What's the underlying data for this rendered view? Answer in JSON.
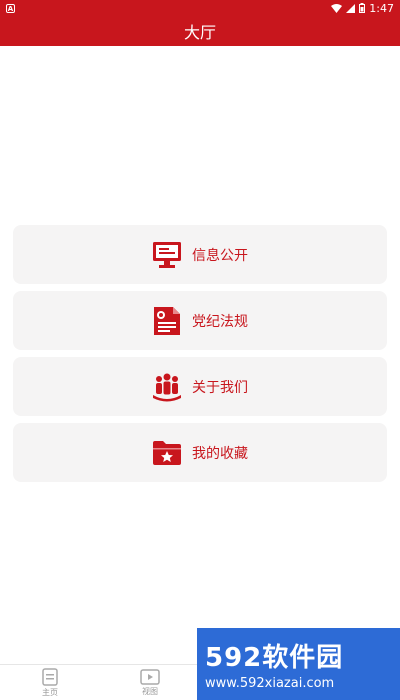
{
  "status_bar": {
    "time": "1:47",
    "notif_icon": "A"
  },
  "header": {
    "title": "大厅"
  },
  "menu": [
    {
      "label": "信息公开",
      "icon": "monitor-icon"
    },
    {
      "label": "党纪法规",
      "icon": "document-icon"
    },
    {
      "label": "关于我们",
      "icon": "people-icon"
    },
    {
      "label": "我的收藏",
      "icon": "folder-star-icon"
    }
  ],
  "tabbar": {
    "tabs": [
      {
        "label": "主页",
        "icon": "home-doc-icon"
      },
      {
        "label": "视图",
        "icon": "video-icon"
      }
    ]
  },
  "watermark": {
    "brand": "592软件园",
    "url": "www.592xiazai.com"
  },
  "colors": {
    "accent": "#c8161d",
    "card_bg": "#f5f4f4",
    "watermark_bg": "#2d6bd6"
  }
}
